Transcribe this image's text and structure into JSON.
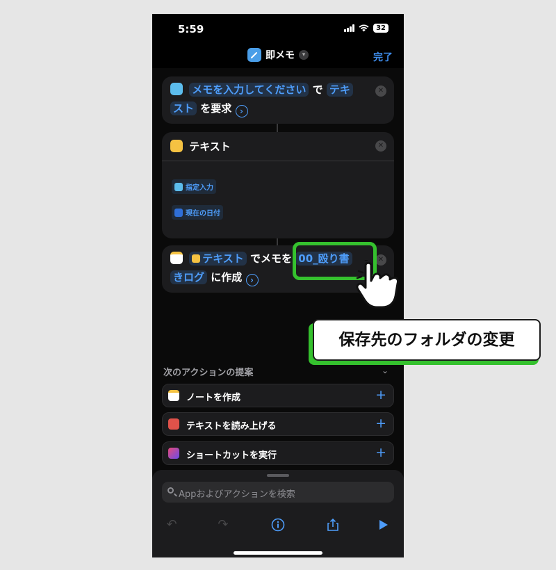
{
  "status_bar": {
    "time": "5:59",
    "battery": "32"
  },
  "nav": {
    "title": "即メモ",
    "done_label": "完了"
  },
  "actions": {
    "ask": {
      "prompt": "メモを入力してください",
      "de": "で",
      "type_a": "テキ",
      "type_b": "スト",
      "suffix": "を要求"
    },
    "text": {
      "title": "テキスト",
      "var1": "指定入力",
      "var2": "現在の日付"
    },
    "note": {
      "var": "テキスト",
      "mid": "でメモを",
      "folder_a": "00_殴り書",
      "folder_b": "きログ",
      "suffix": "に作成"
    }
  },
  "suggestions": {
    "header": "次のアクションの提案",
    "items": [
      {
        "label": "ノートを作成"
      },
      {
        "label": "テキストを読み上げる"
      },
      {
        "label": "ショートカットを実行"
      }
    ]
  },
  "search": {
    "placeholder": "Appおよびアクションを検索"
  },
  "callout": {
    "text": "保存先のフォルダの変更"
  },
  "colors": {
    "accent": "#4e9dfa",
    "highlight": "#35c12e",
    "background": "#000000"
  }
}
